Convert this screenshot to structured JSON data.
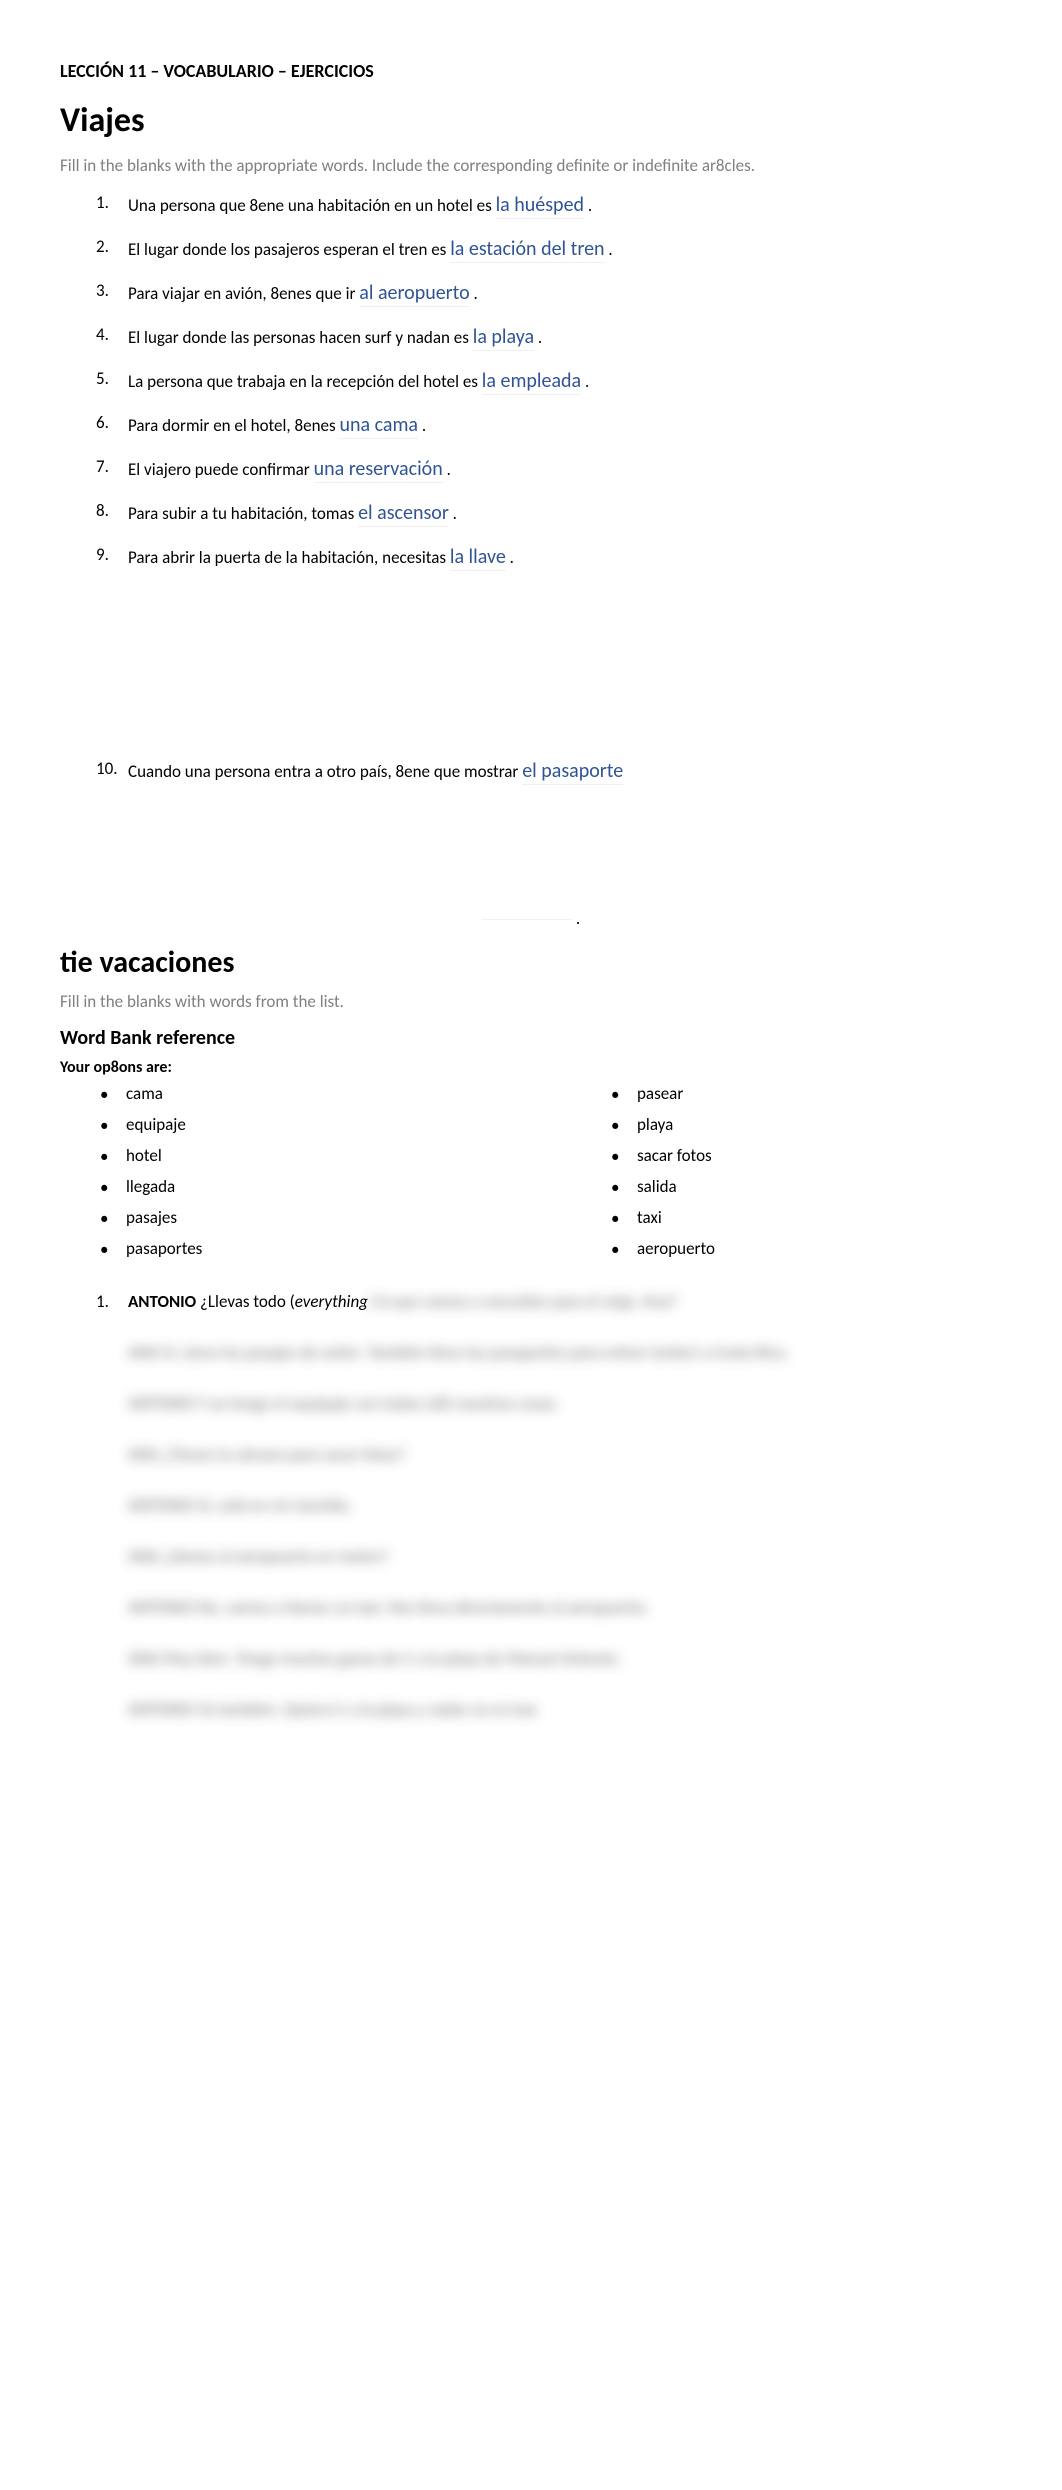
{
  "header": "LECCIÓN 11 – VOCABULARIO – EJERCICIOS",
  "section1": {
    "title": "Viajes",
    "instructions": "Fill in the blanks with the appropriate words. Include the corresponding definite or indefinite ar8cles.",
    "items": [
      {
        "n": "1.",
        "prompt": "Una persona que 8ene una habitación en un hotel es ",
        "answer": "la huésped",
        "trail": "."
      },
      {
        "n": "2.",
        "prompt": "El lugar donde los pasajeros esperan el tren es ",
        "answer": "la estación del tren",
        "trail": "."
      },
      {
        "n": "3.",
        "prompt": "Para viajar en avión, 8enes que ir ",
        "answer": "al aeropuerto",
        "trail": "."
      },
      {
        "n": "4.",
        "prompt": "El lugar donde las personas hacen surf y nadan es ",
        "answer": "la playa",
        "trail": "."
      },
      {
        "n": "5.",
        "prompt": "La persona que trabaja en la recepción del hotel es ",
        "answer": "la empleada",
        "trail": "."
      },
      {
        "n": "6.",
        "prompt": "Para dormir en el hotel, 8enes ",
        "answer": "una cama",
        "trail": "."
      },
      {
        "n": "7.",
        "prompt": "El viajero puede confirmar ",
        "answer": "una reservación",
        "trail": "."
      },
      {
        "n": "8.",
        "prompt": "Para subir a tu habitación, tomas ",
        "answer": "el ascensor",
        "trail": "."
      },
      {
        "n": "9.",
        "prompt": "Para abrir la puerta de la habitación, necesitas ",
        "answer": "la llave",
        "trail": "."
      }
    ],
    "item10": {
      "n": "10.",
      "prompt": "Cuando una persona entra a otro país, 8ene que mostrar ",
      "answer": "el pasaporte"
    },
    "trailing_period": "."
  },
  "section2": {
    "title": "tie vacaciones",
    "instructions": "Fill in the blanks with words from the list.",
    "wordbank_title": "Word Bank reference",
    "options_label": "Your op8ons are:",
    "col1": [
      "cama",
      "equipaje",
      "hotel",
      "llegada",
      "pasajes",
      "pasaportes"
    ],
    "col2": [
      "pasear",
      "playa",
      "sacar fotos",
      "salida",
      "taxi",
      "aeropuerto"
    ],
    "dialogue": {
      "n": "1.",
      "speaker": "ANTONIO",
      "line": " ¿Llevas todo (",
      "italic": "everything",
      "blur_tail": ") lo que vamos a necesitar para el viaje, Ana?"
    },
    "blurred": [
      "ANA Sí. Llevo los pasajes de avión. También llevo los pasaportes para entrar (enter) a Costa Rica.",
      "ANTONIO Y yo tengo el equipaje con todas (all) nuestras cosas.",
      "ANA ¿Tienes la cámara para sacar fotos?",
      "ANTONIO Sí, está en mi mochila.",
      "ANA ¿Vamos al aeropuerto en metro?",
      "ANTONIO No, vamos a llamar un taxi. Nos lleva directamente al aeropuerto.",
      "ANA Muy bien. Tengo muchas ganas de ir a la playa de Manuel Antonio.",
      "ANTONIO Yo también. Quiero ir a la playa y nadar en el mar."
    ]
  }
}
